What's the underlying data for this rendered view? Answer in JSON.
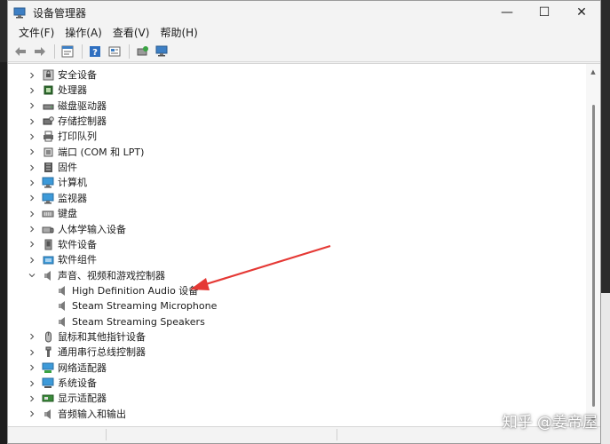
{
  "window": {
    "title": "设备管理器",
    "controls": {
      "minimize": "—",
      "maximize": "☐",
      "close": "✕"
    }
  },
  "menubar": {
    "items": [
      "文件(F)",
      "操作(A)",
      "查看(V)",
      "帮助(H)"
    ]
  },
  "toolbar": {
    "buttons": [
      "back-icon",
      "forward-icon",
      "properties-icon",
      "help-icon",
      "view-icon",
      "update-driver-icon",
      "monitor-icon"
    ]
  },
  "tree": {
    "categories": [
      {
        "label": "安全设备",
        "icon": "security-device-icon",
        "expanded": false
      },
      {
        "label": "处理器",
        "icon": "processor-icon",
        "expanded": false
      },
      {
        "label": "磁盘驱动器",
        "icon": "disk-drive-icon",
        "expanded": false
      },
      {
        "label": "存储控制器",
        "icon": "storage-controller-icon",
        "expanded": false
      },
      {
        "label": "打印队列",
        "icon": "printer-icon",
        "expanded": false
      },
      {
        "label": "端口 (COM 和 LPT)",
        "icon": "port-icon",
        "expanded": false
      },
      {
        "label": "固件",
        "icon": "firmware-icon",
        "expanded": false
      },
      {
        "label": "计算机",
        "icon": "computer-icon",
        "expanded": false
      },
      {
        "label": "监视器",
        "icon": "monitor-icon",
        "expanded": false
      },
      {
        "label": "键盘",
        "icon": "keyboard-icon",
        "expanded": false
      },
      {
        "label": "人体学输入设备",
        "icon": "hid-icon",
        "expanded": false
      },
      {
        "label": "软件设备",
        "icon": "software-device-icon",
        "expanded": false
      },
      {
        "label": "软件组件",
        "icon": "software-component-icon",
        "expanded": false
      },
      {
        "label": "声音、视频和游戏控制器",
        "icon": "speaker-icon",
        "expanded": true
      },
      {
        "label": "鼠标和其他指针设备",
        "icon": "mouse-icon",
        "expanded": false
      },
      {
        "label": "通用串行总线控制器",
        "icon": "usb-icon",
        "expanded": false
      },
      {
        "label": "网络适配器",
        "icon": "network-adapter-icon",
        "expanded": false
      },
      {
        "label": "系统设备",
        "icon": "system-device-icon",
        "expanded": false
      },
      {
        "label": "显示适配器",
        "icon": "display-adapter-icon",
        "expanded": false
      },
      {
        "label": "音频输入和输出",
        "icon": "audio-io-icon",
        "expanded": false
      }
    ],
    "sound_children": [
      {
        "label": "High Definition Audio 设备",
        "icon": "speaker-icon"
      },
      {
        "label": "Steam Streaming Microphone",
        "icon": "speaker-icon"
      },
      {
        "label": "Steam Streaming Speakers",
        "icon": "speaker-icon"
      }
    ]
  },
  "annotation": {
    "color": "#e53935"
  },
  "watermark": {
    "text": "知乎 @姜帝屋"
  }
}
